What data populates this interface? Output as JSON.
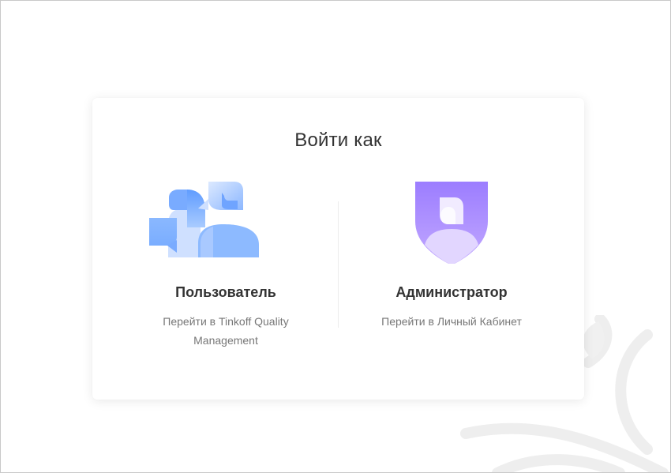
{
  "login": {
    "title": "Войти как"
  },
  "options": [
    {
      "title": "Пользователь",
      "description": "Перейти в Tinkoff Quality Management",
      "icon": "users-chat-icon"
    },
    {
      "title": "Администратор",
      "description": "Перейти в Личный Кабинет",
      "icon": "admin-shield-icon"
    }
  ],
  "colors": {
    "user_blue": "#6fa6ff",
    "admin_purple": "#a98bff",
    "text_dark": "#333333",
    "text_muted": "#777777"
  }
}
